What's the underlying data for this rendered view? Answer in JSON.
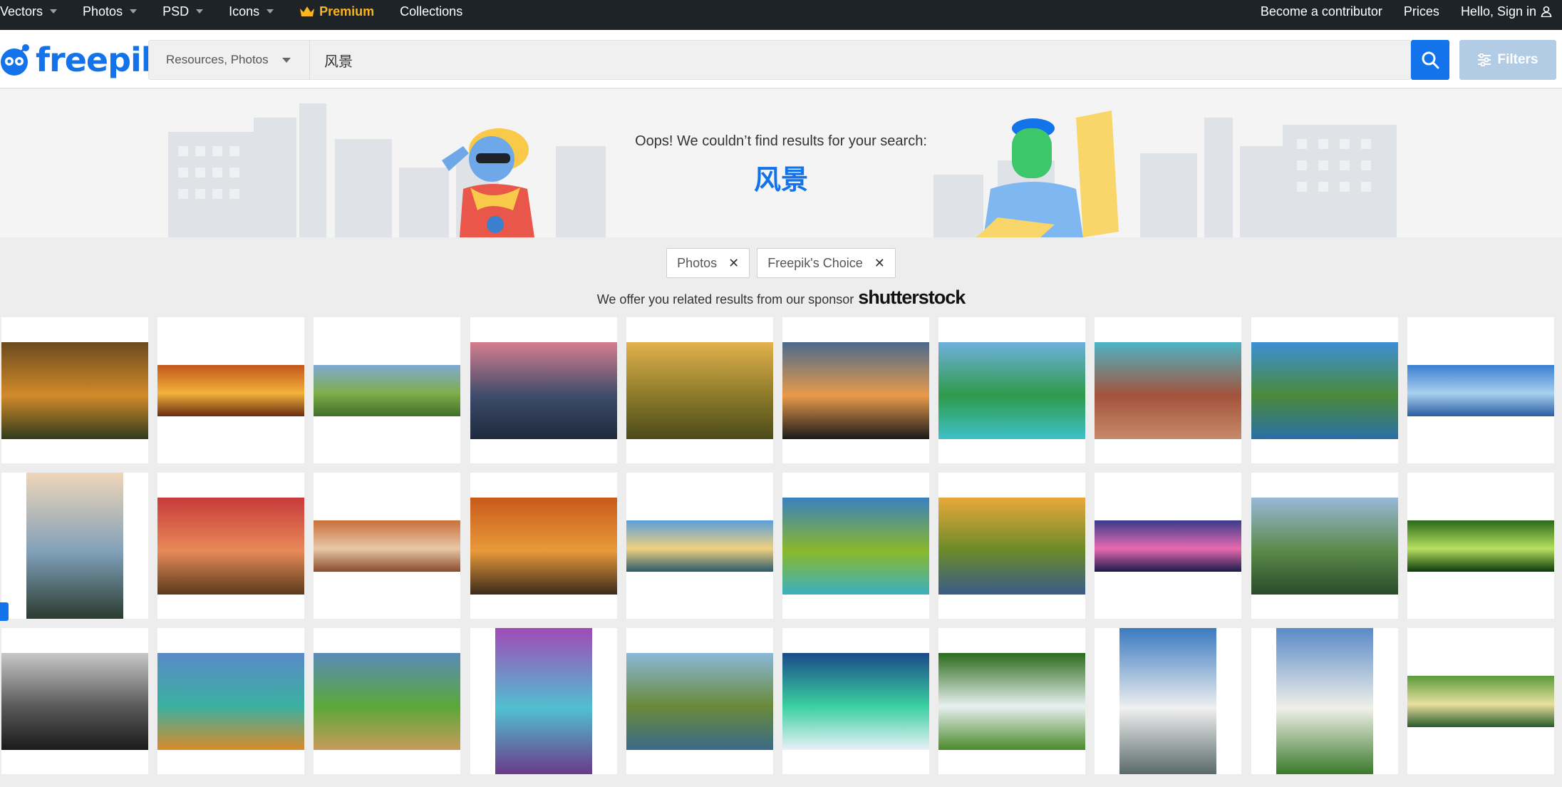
{
  "topnav": {
    "items": [
      {
        "label": "Vectors",
        "has_caret": true
      },
      {
        "label": "Photos",
        "has_caret": true
      },
      {
        "label": "PSD",
        "has_caret": true
      },
      {
        "label": "Icons",
        "has_caret": true
      }
    ],
    "premium_label": "Premium",
    "collections_label": "Collections",
    "contributor_label": "Become a contributor",
    "prices_label": "Prices",
    "signin_label": "Hello, Sign in"
  },
  "header": {
    "logo_text": "freepik",
    "search_type": "Resources, Photos",
    "search_value": "风景",
    "filters_label": "Filters"
  },
  "banner": {
    "message": "Oops! We couldn’t find results for your search:",
    "query": "风景"
  },
  "chips": [
    {
      "label": "Photos"
    },
    {
      "label": "Freepik's Choice"
    }
  ],
  "sponsor": {
    "text": "We offer you related results from our sponsor",
    "brand": "shutterstock"
  },
  "colors": {
    "brand_blue": "#1273eb",
    "premium_gold": "#f9b51f",
    "nav_bg": "#1d2327",
    "filters_bg": "#b3cce6"
  },
  "grid": {
    "rows": 3,
    "cols": 10,
    "images": [
      {
        "name": "autumn-forest-path",
        "orient": "landscape",
        "c1": "#6b4a1e",
        "c2": "#d28a2a",
        "c3": "#2f3b1c"
      },
      {
        "name": "autumn-trees-panorama",
        "orient": "wide",
        "c1": "#c2561c",
        "c2": "#f2b23a",
        "c3": "#6a2b10"
      },
      {
        "name": "green-hills-panorama",
        "orient": "wide",
        "c1": "#7fa9d4",
        "c2": "#7fae4a",
        "c3": "#3f6e2a"
      },
      {
        "name": "waterfall-cliffs",
        "orient": "landscape",
        "c1": "#d67d8f",
        "c2": "#3e4c6b",
        "c3": "#1f2a3e"
      },
      {
        "name": "golden-hills-sunset",
        "orient": "landscape",
        "c1": "#e2b24d",
        "c2": "#8c7a2a",
        "c3": "#4b4a1a"
      },
      {
        "name": "palm-trees-sunset",
        "orient": "landscape",
        "c1": "#4b6a8c",
        "c2": "#e89a4a",
        "c3": "#1a1a1a"
      },
      {
        "name": "tropical-island-pier",
        "orient": "landscape",
        "c1": "#6fb0dc",
        "c2": "#2e9a4a",
        "c3": "#3fc1c9"
      },
      {
        "name": "red-desert-mountains",
        "orient": "landscape",
        "c1": "#4db4c4",
        "c2": "#a3533c",
        "c3": "#c78a6a"
      },
      {
        "name": "lake-village-mountains",
        "orient": "landscape",
        "c1": "#3d8fd6",
        "c2": "#4a8a3a",
        "c3": "#2a6ea8"
      },
      {
        "name": "blue-sky-sea",
        "orient": "wide",
        "c1": "#3a7fd0",
        "c2": "#a9d0f0",
        "c3": "#2a5ea0"
      },
      {
        "name": "sea-sunset-plants",
        "orient": "portrait",
        "c1": "#f0d6b8",
        "c2": "#7f9fb8",
        "c3": "#2a3a2e"
      },
      {
        "name": "red-tree-meadow",
        "orient": "landscape",
        "c1": "#c83a3a",
        "c2": "#e88a5a",
        "c3": "#5a3a1a"
      },
      {
        "name": "rock-arch-canyon",
        "orient": "wide",
        "c1": "#c8703a",
        "c2": "#e8c8a8",
        "c3": "#8a4a2a"
      },
      {
        "name": "autumn-boat-lake",
        "orient": "landscape",
        "c1": "#c85a1a",
        "c2": "#e89a3a",
        "c3": "#3a2a1a"
      },
      {
        "name": "mountain-lake-sunrise",
        "orient": "wide",
        "c1": "#5aa0d8",
        "c2": "#f0d080",
        "c3": "#2a5a6a"
      },
      {
        "name": "green-coast-cliffs",
        "orient": "landscape",
        "c1": "#3a80c0",
        "c2": "#8ab82a",
        "c3": "#3ab0c0"
      },
      {
        "name": "autumn-river",
        "orient": "landscape",
        "c1": "#e8a83a",
        "c2": "#6a8a2a",
        "c3": "#3a5a8a"
      },
      {
        "name": "pink-sunset-pier",
        "orient": "wide",
        "c1": "#3a3a8a",
        "c2": "#e86ab0",
        "c3": "#1a1a4a"
      },
      {
        "name": "karst-valley",
        "orient": "landscape",
        "c1": "#9ab8d8",
        "c2": "#5a8a4a",
        "c3": "#2a4a2a"
      },
      {
        "name": "sunlit-green-forest",
        "orient": "wide",
        "c1": "#2a6a1a",
        "c2": "#b8e060",
        "c3": "#0a3a0a"
      },
      {
        "name": "dark-clouds-mountains",
        "orient": "landscape",
        "c1": "#c8c8c8",
        "c2": "#5a5a5a",
        "c3": "#1a1a1a"
      },
      {
        "name": "alpine-lake-autumn",
        "orient": "landscape",
        "c1": "#5a8ac8",
        "c2": "#3ab0a0",
        "c3": "#d88a2a"
      },
      {
        "name": "green-mountain-meadow",
        "orient": "landscape",
        "c1": "#5a8ab8",
        "c2": "#5aa83a",
        "c3": "#c89a5a"
      },
      {
        "name": "purple-trees-river",
        "orient": "portrait",
        "c1": "#a04ab8",
        "c2": "#50c0d0",
        "c3": "#6a3a8a"
      },
      {
        "name": "mountain-lake-reflection",
        "orient": "landscape",
        "c1": "#8ab8d8",
        "c2": "#6a8a3a",
        "c3": "#3a6a8a"
      },
      {
        "name": "aurora-snow-forest",
        "orient": "landscape",
        "c1": "#1a4a8a",
        "c2": "#3ad0a0",
        "c3": "#e8f0f8"
      },
      {
        "name": "twin-waterfalls",
        "orient": "landscape",
        "c1": "#2a6a1a",
        "c2": "#e8f0f0",
        "c3": "#4a8a2a"
      },
      {
        "name": "clouds-over-sea",
        "orient": "portrait",
        "c1": "#3a7ac0",
        "c2": "#f0f0f0",
        "c3": "#5a6a6a"
      },
      {
        "name": "green-hills-sky",
        "orient": "portrait",
        "c1": "#5a8ac8",
        "c2": "#f0f0e8",
        "c3": "#3a7a2a"
      },
      {
        "name": "river-green-valley",
        "orient": "wide",
        "c1": "#5a9a3a",
        "c2": "#e8e0a0",
        "c3": "#2a5a2a"
      }
    ]
  }
}
